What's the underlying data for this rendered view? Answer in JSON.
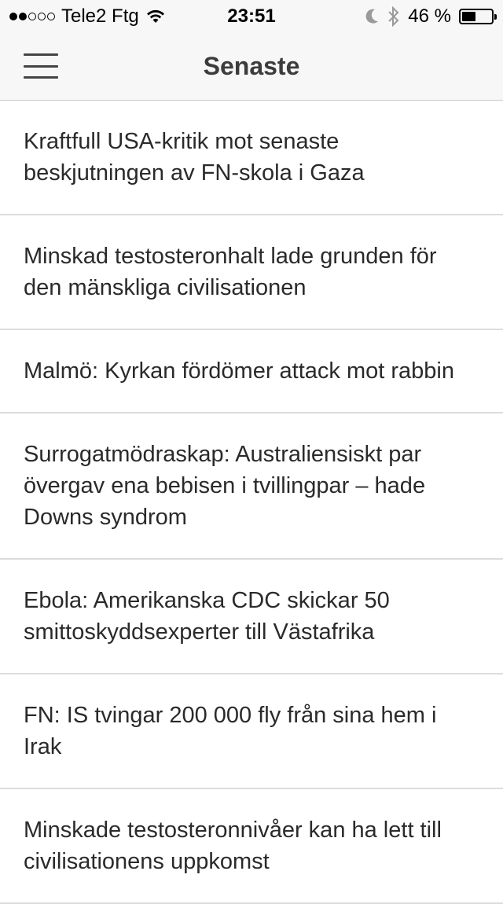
{
  "status_bar": {
    "carrier": "Tele2 Ftg",
    "signal_filled": 2,
    "signal_total": 5,
    "time": "23:51",
    "battery_text": "46 %",
    "battery_level": 0.46,
    "icons": [
      "wifi-icon",
      "moon-icon",
      "bluetooth-icon",
      "battery-icon"
    ]
  },
  "nav": {
    "title": "Senaste",
    "menu_icon": "hamburger-menu-icon"
  },
  "articles": [
    "Kraftfull USA-kritik mot senaste beskjutningen av FN-skola i Gaza",
    "Minskad testosteronhalt lade grunden för den mänskliga civilisationen",
    "Malmö: Kyrkan fördömer attack mot rabbin",
    "Surrogatmödraskap: Australiensiskt par övergav ena bebisen i tvillingpar – hade Downs syndrom",
    "Ebola: Amerikanska CDC skickar 50 smittoskyddsexperter till Västafrika",
    "FN: IS tvingar 200 000 fly från sina hem i Irak",
    "Minskade testosteronnivåer kan ha lett till civilisationens uppkomst"
  ]
}
